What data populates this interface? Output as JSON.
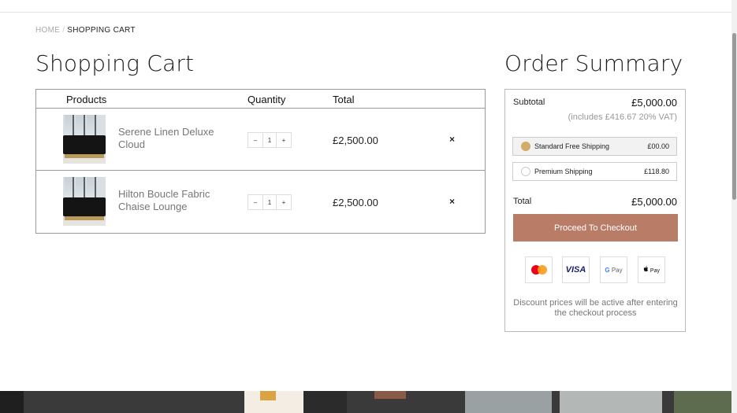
{
  "breadcrumb": {
    "home": "HOME",
    "separator": "/",
    "current": "SHOPPING CART"
  },
  "cart": {
    "title": "Shopping Cart",
    "headers": {
      "products": "Products",
      "quantity": "Quantity",
      "total": "Total"
    },
    "items": [
      {
        "name": "Serene Linen Deluxe Cloud",
        "qty": "1",
        "total": "£2,500.00",
        "minus": "–",
        "plus": "+",
        "remove": "×"
      },
      {
        "name": "Hilton Boucle Fabric Chaise Lounge",
        "qty": "1",
        "total": "£2,500.00",
        "minus": "–",
        "plus": "+",
        "remove": "×"
      }
    ]
  },
  "summary": {
    "title": "Order Summary",
    "subtotal_label": "Subtotal",
    "subtotal_value": "£5,000.00",
    "vat_note": "(includes £416.67 20% VAT)",
    "shipping": [
      {
        "name": "Standard Free Shipping",
        "price": "£00.00",
        "selected": true
      },
      {
        "name": "Premium Shipping",
        "price": "£118.80",
        "selected": false
      }
    ],
    "total_label": "Total",
    "total_value": "£5,000.00",
    "checkout_label": "Proceed To Checkout",
    "payment_methods": {
      "mastercard_icon": "mastercard-icon",
      "visa": "VISA",
      "gpay_g": "G",
      "gpay_rest": " Pay",
      "apple_pay": " Pay"
    },
    "discount_note": "Discount prices will be active after entering the checkout process"
  },
  "colors": {
    "accent": "#b97c66",
    "selected_radio": "#d1ac6a"
  }
}
